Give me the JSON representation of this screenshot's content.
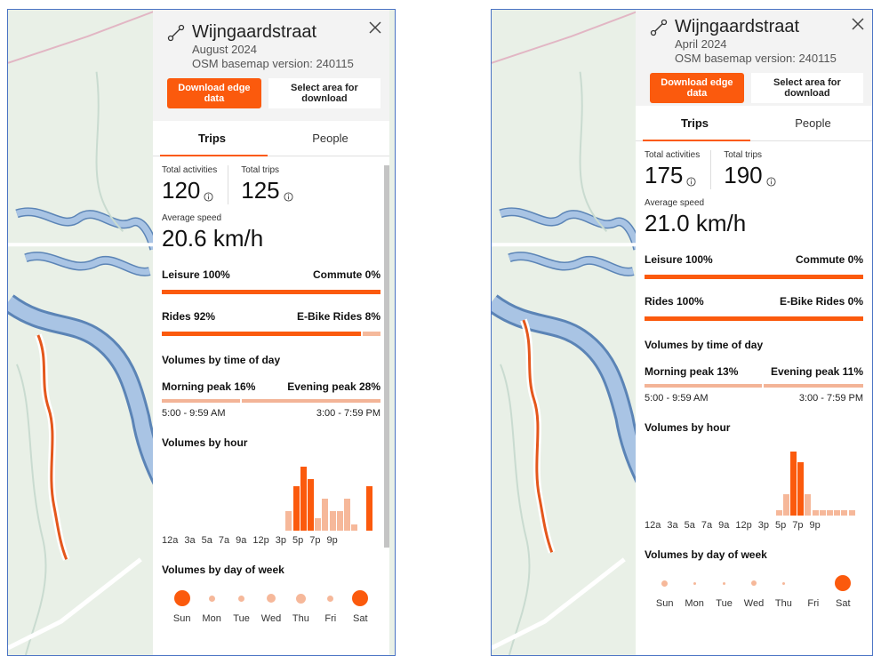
{
  "colors": {
    "accent": "#fb5a0d",
    "accent_light": "#f5b99b",
    "map_land": "#e9f0e7",
    "river": "#5b84b6"
  },
  "panels": [
    {
      "title": "Wijngaardstraat",
      "period": "August 2024",
      "basemap": "OSM basemap version: 240115",
      "btn_download": "Download edge data",
      "btn_select": "Select area for download",
      "tab_trips": "Trips",
      "tab_people": "People",
      "total_activities_label": "Total activities",
      "total_activities": "120",
      "total_trips_label": "Total trips",
      "total_trips": "125",
      "avg_speed_label": "Average speed",
      "avg_speed": "20.6 km/h",
      "leisure": "Leisure 100%",
      "commute": "Commute 0%",
      "leisure_pct": 100,
      "rides": "Rides 92%",
      "ebike": "E-Bike Rides 8%",
      "rides_pct": 92,
      "tod_title": "Volumes by time of day",
      "morning_peak": "Morning peak 16%",
      "evening_peak": "Evening peak 28%",
      "morning_time": "5:00 - 9:59 AM",
      "evening_time": "3:00 - 7:59 PM",
      "hour_title": "Volumes by hour",
      "hour_axis": [
        "12a",
        "3a",
        "5a",
        "7a",
        "9a",
        "12p",
        "3p",
        "5p",
        "7p",
        "9p"
      ],
      "dow_title": "Volumes by day of week",
      "days": [
        "Sun",
        "Mon",
        "Tue",
        "Wed",
        "Thu",
        "Fri",
        "Sat"
      ],
      "hour_volumes": [
        0,
        0,
        0,
        0,
        0,
        0,
        0,
        3,
        7,
        10,
        8,
        2,
        5,
        3,
        3,
        5,
        1,
        0,
        7,
        0,
        0,
        0,
        0,
        0
      ],
      "day_volumes": [
        16,
        6,
        6,
        9,
        10,
        6,
        16
      ]
    },
    {
      "title": "Wijngaardstraat",
      "period": "April 2024",
      "basemap": "OSM basemap version: 240115",
      "btn_download": "Download edge data",
      "btn_select": "Select area for download",
      "tab_trips": "Trips",
      "tab_people": "People",
      "total_activities_label": "Total activities",
      "total_activities": "175",
      "total_trips_label": "Total trips",
      "total_trips": "190",
      "avg_speed_label": "Average speed",
      "avg_speed": "21.0 km/h",
      "leisure": "Leisure 100%",
      "commute": "Commute 0%",
      "leisure_pct": 100,
      "rides": "Rides 100%",
      "ebike": "E-Bike Rides 0%",
      "rides_pct": 100,
      "tod_title": "Volumes by time of day",
      "morning_peak": "Morning peak 13%",
      "evening_peak": "Evening peak 11%",
      "morning_time": "5:00 - 9:59 AM",
      "evening_time": "3:00 - 7:59 PM",
      "hour_title": "Volumes by hour",
      "hour_axis": [
        "12a",
        "3a",
        "5a",
        "7a",
        "9a",
        "12p",
        "3p",
        "5p",
        "7p",
        "9p"
      ],
      "dow_title": "Volumes by day of week",
      "days": [
        "Sun",
        "Mon",
        "Tue",
        "Wed",
        "Thu",
        "Fri",
        "Sat"
      ],
      "hour_volumes": [
        0,
        0,
        0,
        0,
        0,
        0,
        0,
        0,
        1,
        4,
        12,
        10,
        4,
        1,
        1,
        1,
        1,
        1,
        1,
        0,
        0,
        0,
        0,
        0
      ],
      "day_volumes": [
        6,
        3,
        3,
        5,
        2,
        0,
        16
      ]
    }
  ]
}
